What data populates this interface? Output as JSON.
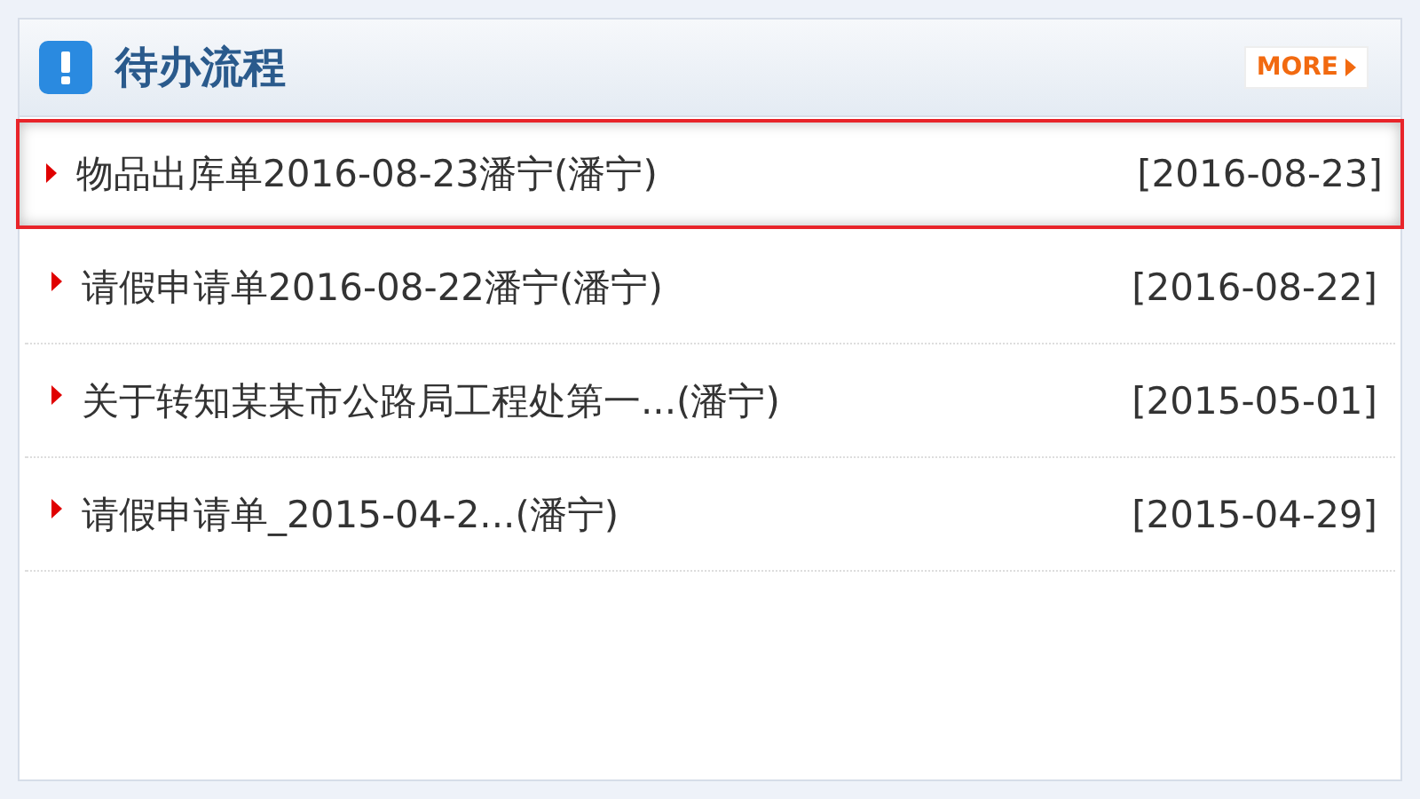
{
  "panel": {
    "title": "待办流程",
    "more": "MORE"
  },
  "items": [
    {
      "title": "物品出库单2016-08-23潘宁(潘宁)",
      "date": "[2016-08-23]",
      "selected": true
    },
    {
      "title": "请假申请单2016-08-22潘宁(潘宁)",
      "date": "[2016-08-22]",
      "selected": false
    },
    {
      "title": "关于转知某某市公路局工程处第一...(潘宁)",
      "date": "[2015-05-01]",
      "selected": false
    },
    {
      "title": "请假申请单_2015-04-2...(潘宁)",
      "date": "[2015-04-29]",
      "selected": false
    }
  ]
}
